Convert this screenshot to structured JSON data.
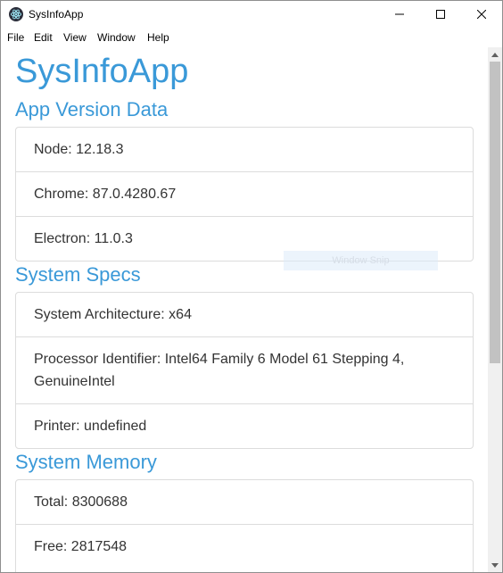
{
  "window": {
    "title": "SysInfoApp",
    "app_icon": "electron-atom-icon"
  },
  "menu": {
    "items": [
      "File",
      "Edit",
      "View",
      "Window",
      "Help"
    ]
  },
  "page": {
    "heading": "SysInfoApp"
  },
  "sections": {
    "app_version": {
      "heading": "App Version Data",
      "items": [
        "Node: 12.18.3",
        "Chrome: 87.0.4280.67",
        "Electron: 11.0.3"
      ]
    },
    "system_specs": {
      "heading": "System Specs",
      "items": [
        "System Architecture: x64",
        "Processor Identifier: Intel64 Family 6 Model 61 Stepping 4, GenuineIntel",
        "Printer: undefined"
      ]
    },
    "system_memory": {
      "heading": "System Memory",
      "items": [
        "Total: 8300688",
        "Free: 2817548"
      ]
    }
  },
  "overlay": {
    "snip_label": "Window Snip"
  },
  "colors": {
    "accent": "#3a99d8",
    "text": "#333333",
    "border": "#dcdcdc"
  }
}
